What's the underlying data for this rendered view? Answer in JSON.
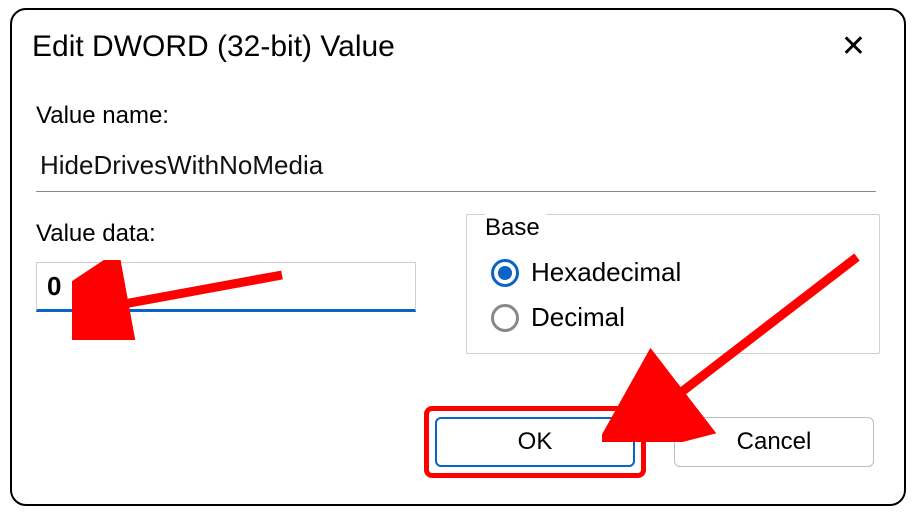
{
  "dialog": {
    "title": "Edit DWORD (32-bit) Value",
    "close_glyph": "✕"
  },
  "value_name": {
    "label": "Value name:",
    "value": "HideDrivesWithNoMedia"
  },
  "value_data": {
    "label": "Value data:",
    "value": "0"
  },
  "base": {
    "legend": "Base",
    "options": {
      "hex": "Hexadecimal",
      "dec": "Decimal"
    },
    "selected": "hex"
  },
  "buttons": {
    "ok": "OK",
    "cancel": "Cancel"
  },
  "colors": {
    "accent": "#0a63c9",
    "annotation": "#ff0000"
  }
}
